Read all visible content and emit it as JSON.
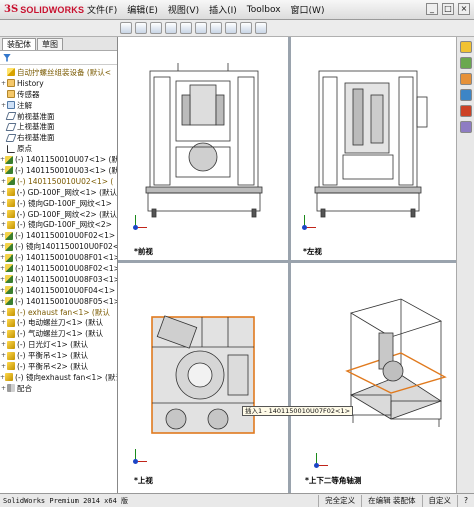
{
  "titlebar": {
    "logo_ds": "3S",
    "logo_text": "SOLIDWORKS",
    "menu": [
      "文件(F)",
      "编辑(E)",
      "视图(V)",
      "插入(I)",
      "Toolbox",
      "窗口(W)"
    ],
    "win_buttons": [
      "_",
      "□",
      "×"
    ]
  },
  "left_panel": {
    "tabs": [
      "装配体",
      "草图"
    ],
    "tree": [
      {
        "label": "自动拧螺丝组装设备  (默认<",
        "icon": "root",
        "expand": "",
        "hl": true
      },
      {
        "label": "History",
        "icon": "folder",
        "expand": "+"
      },
      {
        "label": "传感器",
        "icon": "folder",
        "expand": ""
      },
      {
        "label": "注解",
        "icon": "note",
        "expand": "+"
      },
      {
        "label": "前视基准面",
        "icon": "plane",
        "expand": ""
      },
      {
        "label": "上视基准面",
        "icon": "plane",
        "expand": ""
      },
      {
        "label": "右视基准面",
        "icon": "plane",
        "expand": ""
      },
      {
        "label": "原点",
        "icon": "origin",
        "expand": ""
      },
      {
        "label": "(-) 1401150010U07<1> (默认",
        "icon": "asm",
        "expand": "+"
      },
      {
        "label": "(-) 1401150010U03<1> (默认",
        "icon": "asm",
        "expand": "+"
      },
      {
        "label": "(-) 1401150010U02<1> (",
        "icon": "asm",
        "expand": "+",
        "hl": true
      },
      {
        "label": "(-) GD-100F_网纹<1> (默认",
        "icon": "part",
        "expand": "+"
      },
      {
        "label": "(-) 镜向GD-100F_网纹<1>",
        "icon": "part",
        "expand": "+"
      },
      {
        "label": "(-) GD-100F_网纹<2> (默认",
        "icon": "part",
        "expand": "+"
      },
      {
        "label": "(-) 镜向GD-100F_网纹<2>",
        "icon": "part",
        "expand": "+"
      },
      {
        "label": "(-) 1401150010U0F02<1> (",
        "icon": "asm",
        "expand": "+"
      },
      {
        "label": "(-) 镜向1401150010U0F02<1",
        "icon": "asm",
        "expand": "+"
      },
      {
        "label": "(-) 1401150010U08F01<1> (",
        "icon": "asm",
        "expand": "+"
      },
      {
        "label": "(-) 1401150010U08F02<1> (",
        "icon": "asm",
        "expand": "+"
      },
      {
        "label": "(-) 1401150010U08F03<1> (默认",
        "icon": "asm",
        "expand": "+"
      },
      {
        "label": "(-) 1401150010U0F04<1> (默认",
        "icon": "asm",
        "expand": "+"
      },
      {
        "label": "(-) 1401150010U08F05<1> (默",
        "icon": "asm",
        "expand": "+"
      },
      {
        "label": "(-) exhaust fan<1> (默认",
        "icon": "part",
        "expand": "+",
        "hl": true
      },
      {
        "label": "(-) 电动螺丝刀<1> (默认",
        "icon": "part",
        "expand": "+"
      },
      {
        "label": "(-) 气动螺丝刀<1> (默认",
        "icon": "part",
        "expand": "+"
      },
      {
        "label": "(-) 日光灯<1> (默认",
        "icon": "part",
        "expand": "+"
      },
      {
        "label": "(-) 平衡吊<1> (默认",
        "icon": "part",
        "expand": "+"
      },
      {
        "label": "(-) 平衡吊<2> (默认",
        "icon": "part",
        "expand": "+"
      },
      {
        "label": "(-) 镜向exhaust fan<1> (默认",
        "icon": "part",
        "expand": "+"
      },
      {
        "label": "配合",
        "icon": "mate",
        "expand": "+"
      }
    ]
  },
  "views": {
    "front": "*前视",
    "left": "*左视",
    "top": "*上视",
    "iso": "*上下二等角轴测"
  },
  "tooltip": "插入1 - 1401150010U07F02<1>",
  "status": {
    "app": "SolidWorks Premium 2014 x64 版",
    "cells": [
      "完全定义",
      "在编辑 装配体",
      "自定义",
      "?"
    ]
  },
  "colors": {
    "brand": "#c8102e",
    "selection": "#e07a1e"
  }
}
